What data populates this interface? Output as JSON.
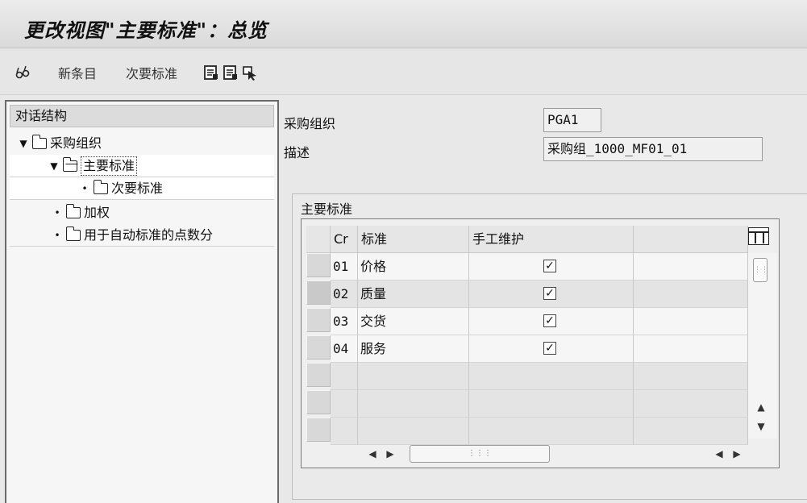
{
  "window": {
    "title": "更改视图\"主要标准\"：总览"
  },
  "toolbar": {
    "new_entry": "新条目",
    "secondary_criteria": "次要标准",
    "icons": [
      "glasses-icon",
      "document-icon",
      "document-icon",
      "cursor-select-icon"
    ]
  },
  "tree": {
    "header": "对话结构",
    "items": [
      {
        "label": "采购组织",
        "bullet": "▼"
      },
      {
        "label": "主要标准",
        "bullet": "▼"
      },
      {
        "label": "次要标准",
        "bullet": "•"
      },
      {
        "label": "加权",
        "bullet": "•"
      },
      {
        "label": "用于自动标准的点数分",
        "bullet": "•"
      }
    ]
  },
  "fields": {
    "purch_org_label": "采购组织",
    "purch_org_value": "PGA1",
    "desc_label": "描述",
    "desc_value": "采购组_1000_MF01_01"
  },
  "table": {
    "group_title": "主要标准",
    "columns": [
      "Cr",
      "标准",
      "手工维护"
    ],
    "rows": [
      {
        "cr": "01",
        "name": "价格",
        "manual": "✓"
      },
      {
        "cr": "02",
        "name": "质量",
        "manual": "✓"
      },
      {
        "cr": "03",
        "name": "交货",
        "manual": "✓"
      },
      {
        "cr": "04",
        "name": "服务",
        "manual": "✓"
      }
    ]
  },
  "colors": {
    "background": "#e8e8e8",
    "panel_border": "#6a6a6a"
  }
}
